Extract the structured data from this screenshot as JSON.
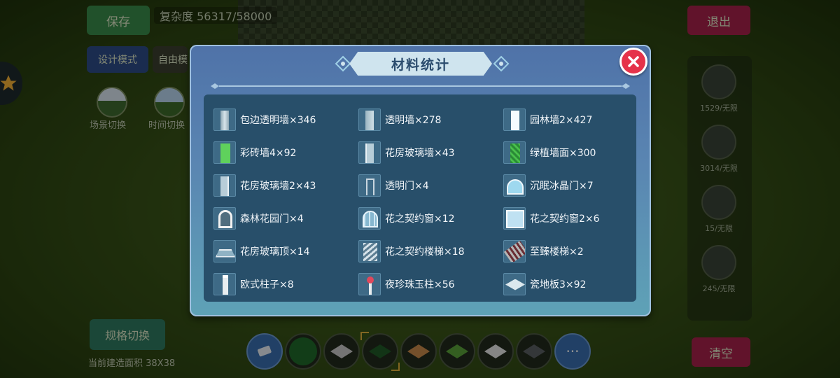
{
  "hud": {
    "save_label": "保存",
    "complexity": "复杂度 56317/58000",
    "design_mode_label": "设计模式",
    "free_mode_label": "自由模",
    "scene_switch_label": "场景切换",
    "time_switch_label": "时间切换",
    "exit_label": "退出",
    "spec_switch_label": "规格切换",
    "build_area_label": "当前建造面积 38X38",
    "clear_label": "清空"
  },
  "right_panel": {
    "items": [
      {
        "label": "1529/无限",
        "icon": "table-icon"
      },
      {
        "label": "3014/无限",
        "icon": "block-icon"
      },
      {
        "label": "15/无限",
        "icon": "cabinet-icon"
      },
      {
        "label": "245/无限",
        "icon": "chair-icon"
      }
    ]
  },
  "toolbar": {
    "tools": [
      {
        "name": "eraser",
        "icon": "eraser-icon"
      },
      {
        "name": "hedge-tile",
        "color": "#1f6a2a"
      },
      {
        "name": "stone-tile",
        "color": "#c9c9c9"
      },
      {
        "name": "grass-tile-selected",
        "color": "#1f5b26"
      },
      {
        "name": "orange-tile",
        "color": "#c98a4a"
      },
      {
        "name": "lawn-tile",
        "color": "#5aa23a"
      },
      {
        "name": "white-tile",
        "color": "#e5e5e5"
      },
      {
        "name": "dark-tile",
        "color": "#5b5f63"
      },
      {
        "name": "more",
        "icon": "more-icon"
      }
    ],
    "more_label": "···"
  },
  "modal": {
    "title": "材料统计",
    "materials": [
      {
        "label": "包边透明墙×346",
        "icon": "glass-wall-icon"
      },
      {
        "label": "透明墙×278",
        "icon": "glass-wall-icon"
      },
      {
        "label": "园林墙2×427",
        "icon": "garden-wall-icon"
      },
      {
        "label": "彩砖墙4×92",
        "icon": "green-brick-wall-icon"
      },
      {
        "label": "花房玻璃墙×43",
        "icon": "greenhouse-glass-wall-icon"
      },
      {
        "label": "绿植墙面×300",
        "icon": "plant-wall-icon"
      },
      {
        "label": "花房玻璃墙2×43",
        "icon": "greenhouse-glass-wall-icon"
      },
      {
        "label": "透明门×4",
        "icon": "glass-door-icon"
      },
      {
        "label": "沉眠冰晶门×7",
        "icon": "ice-crystal-gate-icon"
      },
      {
        "label": "森林花园门×4",
        "icon": "forest-garden-gate-icon"
      },
      {
        "label": "花之契约窗×12",
        "icon": "flower-window-icon"
      },
      {
        "label": "花之契约窗2×6",
        "icon": "flower-window-icon"
      },
      {
        "label": "花房玻璃顶×14",
        "icon": "glass-roof-icon"
      },
      {
        "label": "花之契约楼梯×18",
        "icon": "spiral-stair-icon"
      },
      {
        "label": "至臻楼梯×2",
        "icon": "stair-icon"
      },
      {
        "label": "欧式柱子×8",
        "icon": "pillar-icon"
      },
      {
        "label": "夜珍珠玉柱×56",
        "icon": "pearl-pillar-icon"
      },
      {
        "label": "瓷地板3×92",
        "icon": "tile-floor-icon"
      }
    ]
  },
  "colors": {
    "accent": "#e5334a",
    "modal_top": "#4f72a8",
    "modal_bottom": "#5ea2b6",
    "panel": "#284f6a"
  }
}
